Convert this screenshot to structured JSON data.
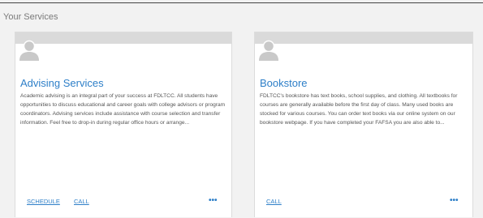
{
  "section": {
    "title": "Your Services"
  },
  "cards": [
    {
      "title": "Advising Services",
      "description": "Academic advising is an integral part of your success at FDLTCC. All students have opportunities to discuss educational and career goals with college advisors or program coordinators. Advising services include assistance with course selection and transfer information. Feel free to drop-in during regular office hours or arrange...",
      "actions": [
        "SCHEDULE",
        "CALL"
      ],
      "more": "•••",
      "avatar_icon": "user-silhouette-icon"
    },
    {
      "title": "Bookstore",
      "description": "FDLTCC's bookstore has text books, school supplies, and clothing. All textbooks for courses are generally available before the first day of class. Many used books are stocked for various courses. You can order text books via our online system on our bookstore webpage. If you have completed your FAFSA you are also able to...",
      "actions": [
        "CALL"
      ],
      "more": "•••",
      "avatar_icon": "user-silhouette-icon"
    }
  ],
  "colors": {
    "accent": "#2e7fc8",
    "card_header": "#dadada",
    "background": "#f2f2f2"
  }
}
